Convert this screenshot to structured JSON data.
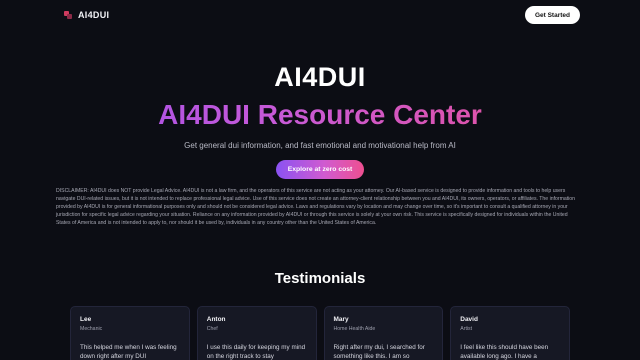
{
  "nav": {
    "brand": "AI4DUI",
    "get_started": "Get Started"
  },
  "hero": {
    "title": "AI4DUI",
    "subtitle": "AI4DUI Resource Center",
    "tagline": "Get general dui information, and fast emotional and motivational help from AI",
    "cta": "Explore at zero cost"
  },
  "disclaimer": "DISCLAIMER: AI4DUI does NOT provide Legal Advice. AI4DUI is not a law firm, and the operators of this service are not acting as your attorney. Our AI-based service is designed to provide information and tools to help users navigate DUI-related issues, but it is not intended to replace professional legal advice. Use of this service does not create an attorney-client relationship between you and AI4DUI, its owners, operators, or affiliates. The information provided by AI4DUI is for general informational purposes only and should not be considered legal advice. Laws and regulations vary by location and may change over time, so it's important to consult a qualified attorney in your jurisdiction for specific legal advice regarding your situation. Reliance on any information provided by AI4DUI or through this service is solely at your own risk. This service is specifically designed for individuals within the United States of America and is not intended to apply to, nor should it be used by, individuals in any country other than the United States of America.",
  "testimonials": {
    "heading": "Testimonials",
    "items": [
      {
        "name": "Lee",
        "role": "Mechanic",
        "quote": "This helped me when I was feeling down right after my DUI"
      },
      {
        "name": "Anton",
        "role": "Chef",
        "quote": "I use this daily for keeping my mind on the right track to stay"
      },
      {
        "name": "Mary",
        "role": "Home Health Aide",
        "quote": "Right after my dui, I searched for something like this. I am so"
      },
      {
        "name": "David",
        "role": "Artist",
        "quote": "I feel like this should have been available long ago. I have a"
      }
    ]
  },
  "colors": {
    "background": "#0c0d14",
    "gradient_start": "#9a4df0",
    "gradient_end": "#ef4e8a",
    "card_bg": "#161824"
  },
  "icons": {
    "brand": "ai4dui-logo-icon"
  }
}
